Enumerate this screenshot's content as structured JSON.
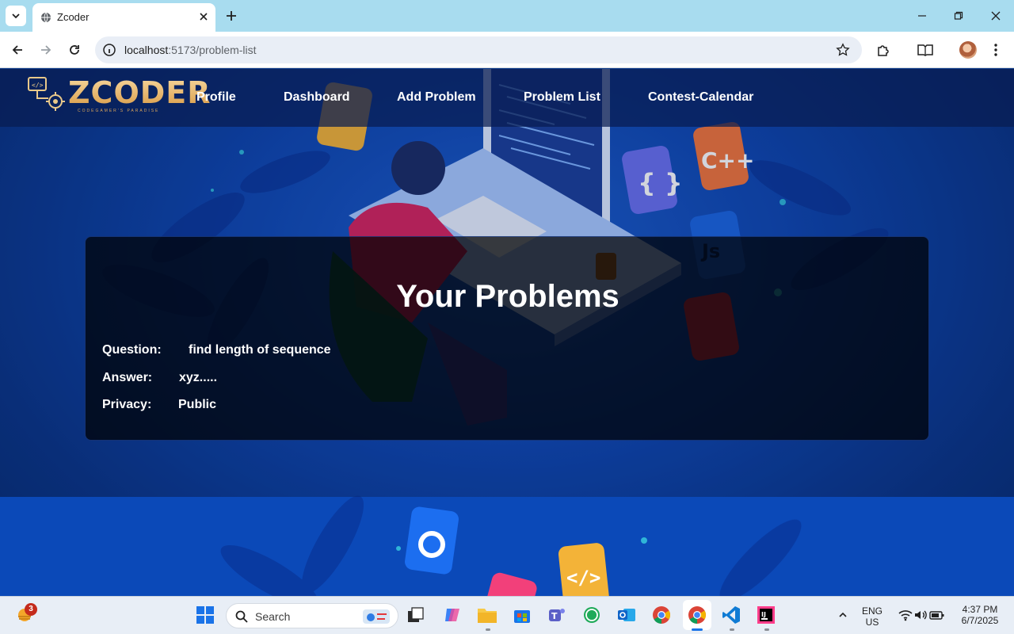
{
  "browser": {
    "tab_title": "Zcoder",
    "url_host": "localhost",
    "url_path": ":5173/problem-list"
  },
  "app": {
    "logo_text": "ZCODER",
    "logo_tagline": "CODEGAMER'S PARADISE",
    "nav": [
      "Profile",
      "Dashboard",
      "Add Problem",
      "Problem List",
      "Contest-Calendar"
    ]
  },
  "panel": {
    "title": "Your Problems",
    "rows": [
      {
        "label": "Question:",
        "value": "find length of sequence"
      },
      {
        "label": "Answer:",
        "value": "xyz....."
      },
      {
        "label": "Privacy:",
        "value": "Public"
      }
    ]
  },
  "taskbar": {
    "weather_badge": "3",
    "search_placeholder": "Search",
    "lang": "ENG",
    "region": "US",
    "time": "4:37 PM",
    "date": "6/7/2025"
  },
  "colors": {
    "tabstrip": "#a8dcef",
    "page_blue": "#0f46b0",
    "logo_gold": "#e8b86a"
  }
}
